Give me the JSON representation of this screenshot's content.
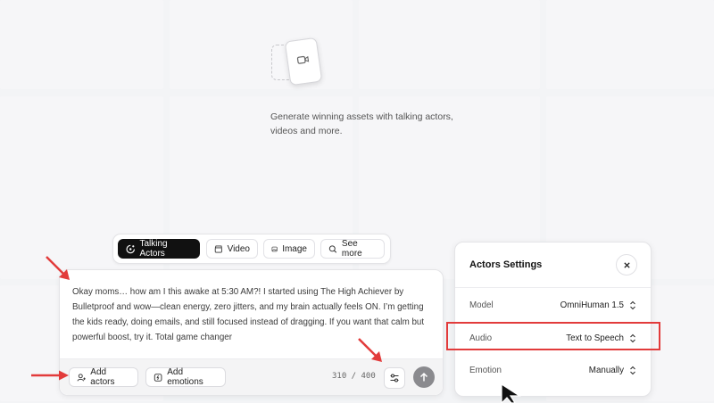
{
  "hero": {
    "headline": "Generate winning assets with talking actors, videos and more."
  },
  "tabs": [
    {
      "label": "Talking Actors",
      "icon": "talking-actors-icon",
      "active": true
    },
    {
      "label": "Video",
      "icon": "clapperboard-icon",
      "active": false
    },
    {
      "label": "Image",
      "icon": "image-icon",
      "active": false
    },
    {
      "label": "See more",
      "icon": "search-icon",
      "active": false
    }
  ],
  "composer": {
    "prompt": "Okay moms… how am I this awake at 5:30 AM?! I started using The High Achiever by Bulletproof and wow—clean energy, zero jitters, and my brain actually feels ON. I’m getting the kids ready, doing emails, and still focused instead of dragging. If you want that calm but powerful boost, try it. Total game changer",
    "add_actors_label": "Add actors",
    "add_emotions_label": "Add emotions",
    "char_count": "310 / 400"
  },
  "settings": {
    "title": "Actors Settings",
    "rows": [
      {
        "label": "Model",
        "value": "OmniHuman 1.5"
      },
      {
        "label": "Audio",
        "value": "Text to Speech"
      },
      {
        "label": "Emotion",
        "value": "Manually"
      }
    ]
  },
  "colors": {
    "annotation": "#e23b3b",
    "active_tab": "#111111"
  }
}
